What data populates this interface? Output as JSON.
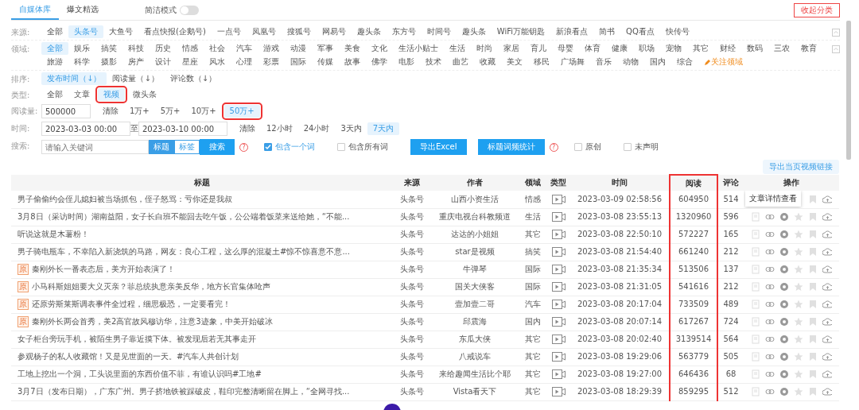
{
  "tabs": [
    {
      "label": "自媒体库",
      "selected": true
    },
    {
      "label": "爆文精选",
      "selected": false
    }
  ],
  "simple_mode": {
    "label": "简洁模式",
    "on": false
  },
  "collapse_button": "收起分类",
  "filters": [
    {
      "kind": "options",
      "label": "来源:",
      "collapsible": true,
      "options": [
        {
          "label": "全部",
          "selected": false
        },
        {
          "label": "头条号",
          "selected": true
        },
        {
          "label": "大鱼号",
          "selected": false
        },
        {
          "label": "看点快报(企鹅号)",
          "selected": false
        },
        {
          "label": "一点号",
          "selected": false
        },
        {
          "label": "凤凰号",
          "selected": false
        },
        {
          "label": "搜狐号",
          "selected": false
        },
        {
          "label": "网易号",
          "selected": false
        },
        {
          "label": "趣头条",
          "selected": false
        },
        {
          "label": "东方号",
          "selected": false
        },
        {
          "label": "时间号",
          "selected": false
        },
        {
          "label": "趣头条",
          "selected": false
        },
        {
          "label": "WiFi万能钥匙",
          "selected": false
        },
        {
          "label": "新浪看点",
          "selected": false
        },
        {
          "label": "简书",
          "selected": false
        },
        {
          "label": "QQ看点",
          "selected": false
        },
        {
          "label": "快传号",
          "selected": false
        }
      ]
    },
    {
      "kind": "options",
      "label": "领域:",
      "collapsible": true,
      "extra_link": "关注领域",
      "options": [
        {
          "label": "全部",
          "selected": true
        },
        {
          "label": "娱乐",
          "selected": false
        },
        {
          "label": "搞笑",
          "selected": false
        },
        {
          "label": "科技",
          "selected": false
        },
        {
          "label": "历史",
          "selected": false
        },
        {
          "label": "情感",
          "selected": false
        },
        {
          "label": "社会",
          "selected": false
        },
        {
          "label": "汽车",
          "selected": false
        },
        {
          "label": "游戏",
          "selected": false
        },
        {
          "label": "动漫",
          "selected": false
        },
        {
          "label": "军事",
          "selected": false
        },
        {
          "label": "美食",
          "selected": false
        },
        {
          "label": "文化",
          "selected": false
        },
        {
          "label": "生活小贴士",
          "selected": false
        },
        {
          "label": "生活",
          "selected": false
        },
        {
          "label": "时尚",
          "selected": false
        },
        {
          "label": "家居",
          "selected": false
        },
        {
          "label": "育儿",
          "selected": false
        },
        {
          "label": "母婴",
          "selected": false
        },
        {
          "label": "体育",
          "selected": false
        },
        {
          "label": "健康",
          "selected": false
        },
        {
          "label": "职场",
          "selected": false
        },
        {
          "label": "宠物",
          "selected": false
        },
        {
          "label": "其它",
          "selected": false
        },
        {
          "label": "财经",
          "selected": false
        },
        {
          "label": "数码",
          "selected": false
        },
        {
          "label": "三农",
          "selected": false
        },
        {
          "label": "教育",
          "selected": false
        },
        {
          "label": "旅游",
          "selected": false
        },
        {
          "label": "科学",
          "selected": false
        },
        {
          "label": "摄影",
          "selected": false
        },
        {
          "label": "房产",
          "selected": false
        },
        {
          "label": "设计",
          "selected": false
        },
        {
          "label": "星座",
          "selected": false
        },
        {
          "label": "风水",
          "selected": false
        },
        {
          "label": "心理",
          "selected": false
        },
        {
          "label": "彩票",
          "selected": false
        },
        {
          "label": "国际",
          "selected": false
        },
        {
          "label": "传媒",
          "selected": false
        },
        {
          "label": "故事",
          "selected": false
        },
        {
          "label": "佛学",
          "selected": false
        },
        {
          "label": "电影",
          "selected": false
        },
        {
          "label": "技术",
          "selected": false
        },
        {
          "label": "曲艺",
          "selected": false
        },
        {
          "label": "收藏",
          "selected": false
        },
        {
          "label": "美文",
          "selected": false
        },
        {
          "label": "移民",
          "selected": false
        },
        {
          "label": "广场舞",
          "selected": false
        },
        {
          "label": "音乐",
          "selected": false
        },
        {
          "label": "动物",
          "selected": false
        },
        {
          "label": "国内",
          "selected": false
        },
        {
          "label": "综合",
          "selected": false
        }
      ]
    },
    {
      "kind": "options",
      "label": "排序:",
      "options": [
        {
          "label": "发布时间（↓）",
          "selected": true
        },
        {
          "label": "阅读量（↓）",
          "selected": false
        },
        {
          "label": "评论数（↓）",
          "selected": false
        }
      ]
    },
    {
      "kind": "options",
      "label": "类型:",
      "options": [
        {
          "label": "全部",
          "selected": false,
          "highlighted": false
        },
        {
          "label": "文章",
          "selected": false,
          "highlighted": false
        },
        {
          "label": "视频",
          "selected": true,
          "highlighted": true
        },
        {
          "label": "微头条",
          "selected": false,
          "highlighted": false
        }
      ]
    },
    {
      "kind": "options",
      "label": "阅读量:",
      "input": "500000",
      "options": [
        {
          "label": "清除",
          "selected": false,
          "highlighted": false
        },
        {
          "label": "1万+",
          "selected": false,
          "highlighted": false
        },
        {
          "label": "5万+",
          "selected": false,
          "highlighted": false
        },
        {
          "label": "10万+",
          "selected": false,
          "highlighted": false
        },
        {
          "label": "50万+",
          "selected": true,
          "highlighted": true
        }
      ]
    },
    {
      "kind": "range",
      "label": "时间:",
      "from": "2023-03-03 00:00",
      "separator": "至",
      "to": "2023-03-10 00:00",
      "options": [
        {
          "label": "清除",
          "selected": false
        },
        {
          "label": "12小时",
          "selected": false
        },
        {
          "label": "24小时",
          "selected": false
        },
        {
          "label": "3天内",
          "selected": false
        },
        {
          "label": "7天内",
          "selected": true
        }
      ]
    }
  ],
  "search": {
    "label": "搜索:",
    "placeholder": "请输入关键词",
    "scopes": [
      {
        "label": "标题",
        "selected": true
      },
      {
        "label": "标签",
        "selected": false
      }
    ],
    "button": "搜索",
    "help": "?",
    "items": [
      {
        "kind": "checkbox",
        "label": "包含一个词",
        "checked": true
      },
      {
        "kind": "checkbox",
        "label": "包含所有词",
        "checked": false
      },
      {
        "kind": "button",
        "label": "导出Excel"
      },
      {
        "kind": "button",
        "label": "标题词频统计",
        "help": "?"
      },
      {
        "kind": "checkbox",
        "label": "原创",
        "checked": false
      },
      {
        "kind": "checkbox",
        "label": "未声明",
        "checked": false
      }
    ]
  },
  "export_link_button": "导出当页视频链接",
  "table": {
    "columns": [
      {
        "label": "标题",
        "highlighted": false
      },
      {
        "label": "来源",
        "highlighted": false
      },
      {
        "label": "作者",
        "highlighted": false
      },
      {
        "label": "领域",
        "highlighted": false
      },
      {
        "label": "类型",
        "highlighted": false
      },
      {
        "label": "时间",
        "highlighted": false
      },
      {
        "label": "阅读",
        "highlighted": true
      },
      {
        "label": "评论",
        "highlighted": false
      },
      {
        "label": "操作",
        "highlighted": false
      }
    ],
    "rows": [
      {
        "tooltip": "文章详情查看",
        "title": "男子偷偷约会侄儿媳妇被当场抓包，侄子怒骂：亏你还是我叔",
        "source": "头条号",
        "author": "山西小资生活",
        "domain": "情感",
        "time": "2023-03-09 02:58:56",
        "reads": "604950",
        "comments": "514"
      },
      {
        "title": "3月8日（采访时间）湖南益阳，女子长白班不能回去吃午饭，公公端着饭菜来送给她，“不能...",
        "source": "头条号",
        "author": "重庆电视台科教频道",
        "domain": "生活",
        "time": "2023-03-08 23:55:13",
        "reads": "1320960",
        "comments": "596"
      },
      {
        "title": "听说这就是木薯粉！",
        "source": "头条号",
        "author": "达达的小姐姐",
        "domain": "其它",
        "time": "2023-03-08 22:50:10",
        "reads": "572227",
        "comments": "165"
      },
      {
        "title": "男子骑电瓶车，不幸陷入新浇筑的马路，网友：良心工程，这么厚的混凝土#惊不惊喜意不意...",
        "source": "头条号",
        "author": "star是视频",
        "domain": "搞笑",
        "time": "2023-03-08 21:54:40",
        "reads": "661240",
        "comments": "212"
      },
      {
        "badge": "原",
        "title": "秦刚外长一番表态后，美方开始表演了！",
        "source": "头条号",
        "author": "牛弹琴",
        "domain": "国际",
        "time": "2023-03-08 21:35:34",
        "reads": "513506",
        "comments": "137"
      },
      {
        "badge": "原",
        "title": "小马科斯姐姐要大义灭亲？菲总统执意亲美反华，地方长官集体呛声",
        "source": "头条号",
        "author": "国关大侠客",
        "domain": "国际",
        "time": "2023-03-08 21:31:05",
        "reads": "541616",
        "comments": "212"
      },
      {
        "badge": "原",
        "title": "还原劳斯莱斯调表事件全过程，细思极恐，一定要看完！",
        "source": "头条号",
        "author": "壹加壹二哥",
        "domain": "汽车",
        "time": "2023-03-08 20:17:04",
        "reads": "733509",
        "comments": "489"
      },
      {
        "badge": "原",
        "title": "秦刚外长两会首秀，美2高官故风穆访华，注意3迹象，中美开始破冰",
        "source": "头条号",
        "author": "邱震海",
        "domain": "国内",
        "time": "2023-03-08 20:07:14",
        "reads": "617267",
        "comments": "724"
      },
      {
        "title": "女子柜台旁玩手机，被陌生男子靠近摸下体。被发现后若无其事走开",
        "source": "头条号",
        "author": "东瓜大侠",
        "domain": "其它",
        "time": "2023-03-08 20:02:40",
        "reads": "3139514",
        "comments": "564"
      },
      {
        "title": "参观杨子的私人收藏馆！又是见世面的一天。#汽车人共创计划",
        "source": "头条号",
        "author": "八戒说车",
        "domain": "其它",
        "time": "2023-03-08 19:29:06",
        "reads": "563779",
        "comments": "505"
      },
      {
        "title": "工地上挖出一个洞，工头说里面的东西价值不菲，有谁认识吗#工地#",
        "source": "头条号",
        "author": "来给趣闻生活比个耶",
        "domain": "其它",
        "time": "2023-03-08 19:27:00",
        "reads": "646436",
        "comments": "68"
      },
      {
        "title": "3月7日（发布日期），广东广州。男子挤地铁被踩破皮，鞋印完整清晰留在脚上，“全网寻找...",
        "source": "头条号",
        "author": "Vista看天下",
        "domain": "其它",
        "time": "2023-03-08 18:29:39",
        "reads": "859295",
        "comments": "512"
      }
    ]
  }
}
